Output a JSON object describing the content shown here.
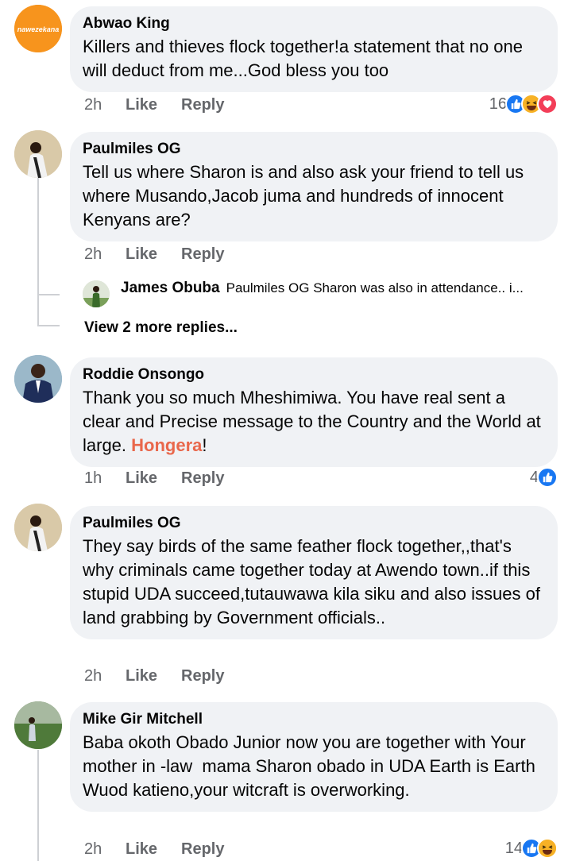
{
  "comments": [
    {
      "author": "Abwao King",
      "avatar_text": "nawezekana",
      "text": "Killers and thieves flock together!a statement that no one will deduct from me...God bless you too",
      "time": "2h",
      "like_label": "Like",
      "reply_label": "Reply",
      "reaction_count": "16",
      "reactions": [
        "like-icon",
        "haha-icon",
        "love-icon"
      ]
    },
    {
      "author": "Paulmiles OG",
      "text": "Tell us where Sharon is and also ask your friend to tell us where Musando,Jacob juma and hundreds of innocent Kenyans are?",
      "time": "2h",
      "like_label": "Like",
      "reply_label": "Reply",
      "reply_preview": {
        "author": "James Obuba",
        "text": "Paulmiles OG Sharon was also in attendance.. i..."
      },
      "more_replies": "View 2 more replies..."
    },
    {
      "author": "Roddie Onsongo",
      "text": "Thank you so much Mheshimiwa. You have real sent a clear and Precise message to the Country and the World at large. ",
      "highlight": "Hongera",
      "text_end": "!",
      "time": "1h",
      "like_label": "Like",
      "reply_label": "Reply",
      "reaction_count": "4",
      "reactions": [
        "like-icon"
      ]
    },
    {
      "author": "Paulmiles OG",
      "text": "They say birds of the same feather flock together,,that's why criminals came together today at Awendo town..if this stupid UDA succeed,tutauwawa kila siku and also issues of land grabbing by Government officials..",
      "time": "2h",
      "like_label": "Like",
      "reply_label": "Reply"
    },
    {
      "author": "Mike Gir Mitchell",
      "text": "Baba okoth Obado Junior now you are together with Your mother in -law  mama Sharon obado in UDA Earth is Earth Wuod katieno,your witcraft is overworking.",
      "time": "2h",
      "like_label": "Like",
      "reply_label": "Reply",
      "reaction_count": "14",
      "reactions": [
        "like-icon",
        "haha-icon"
      ]
    }
  ],
  "colors": {
    "bubble": "#f0f2f5",
    "secondary_text": "#65676b",
    "like_blue": "#1877f2",
    "haha_yellow": "#f7b125",
    "love_red": "#f33e58",
    "highlight": "#e9674b"
  }
}
